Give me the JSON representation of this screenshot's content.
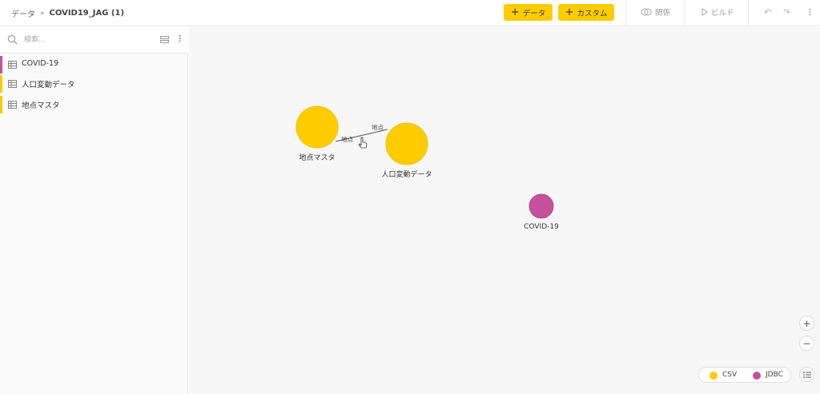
{
  "breadcrumb": {
    "root": "データ",
    "separator": "»",
    "current": "COVID19_JAG (1)"
  },
  "toolbar": {
    "add_data_label": "データ",
    "add_custom_label": "カスタム",
    "relation_label": "関係",
    "build_label": "ビルド"
  },
  "sidebar": {
    "search_placeholder": "検索...",
    "items": [
      {
        "label": "COVID-19",
        "color": "#c6519b"
      },
      {
        "label": "人口変動データ",
        "color": "#ffcc00"
      },
      {
        "label": "地点マスタ",
        "color": "#ffcc00"
      }
    ]
  },
  "graph": {
    "nodes": [
      {
        "id": "chiten",
        "label": "地点マスタ",
        "type": "CSV"
      },
      {
        "id": "jinko",
        "label": "人口変動データ",
        "type": "CSV"
      },
      {
        "id": "covid",
        "label": "COVID-19",
        "type": "JDBC"
      }
    ],
    "edge": {
      "from": "chiten",
      "to": "jinko",
      "from_label": "地点",
      "to_label": "地点"
    }
  },
  "legend": [
    {
      "label": "CSV",
      "color": "#ffcc00"
    },
    {
      "label": "JDBC",
      "color": "#c6519b"
    }
  ],
  "colors": {
    "csv": "#ffcc00",
    "jdbc": "#c6519b",
    "accent": "#ffcc00"
  }
}
